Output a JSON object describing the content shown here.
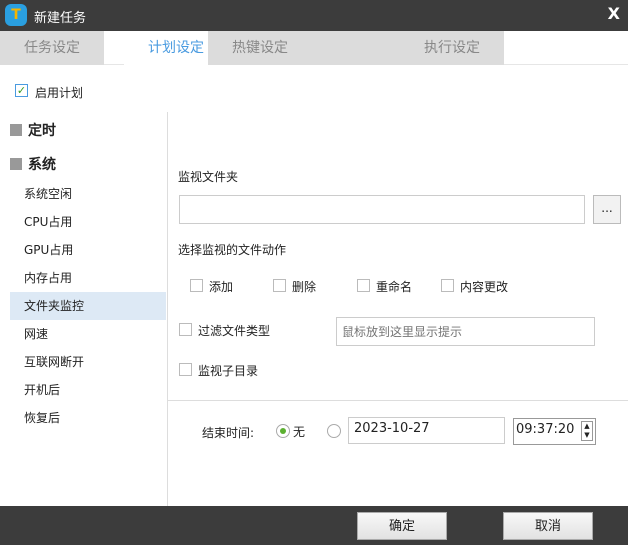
{
  "window": {
    "title": "新建任务",
    "close": "X",
    "logo": "T"
  },
  "tabs": [
    "任务设定",
    "计划设定",
    "热键设定",
    "执行设定"
  ],
  "enable_plan": {
    "label": "启用计划",
    "checked": true
  },
  "sidebar": {
    "groups": [
      "定时",
      "系统"
    ],
    "items": [
      "系统空闲",
      "CPU占用",
      "GPU占用",
      "内存占用",
      "文件夹监控",
      "网速",
      "互联网断开",
      "开机后",
      "恢复后"
    ],
    "selected": "文件夹监控"
  },
  "main": {
    "folder_label": "监视文件夹",
    "folder_value": "",
    "browse": "...",
    "actions_label": "选择监视的文件动作",
    "actions": [
      "添加",
      "删除",
      "重命名",
      "内容更改"
    ],
    "filter_label": "过滤文件类型",
    "filter_placeholder": "鼠标放到这里显示提示",
    "subdir_label": "监视子目录"
  },
  "end_time": {
    "label": "结束时间:",
    "none_label": "无",
    "date": "2023-10-27",
    "time": "09:37:20"
  },
  "footer": {
    "ok": "确定",
    "cancel": "取消"
  }
}
